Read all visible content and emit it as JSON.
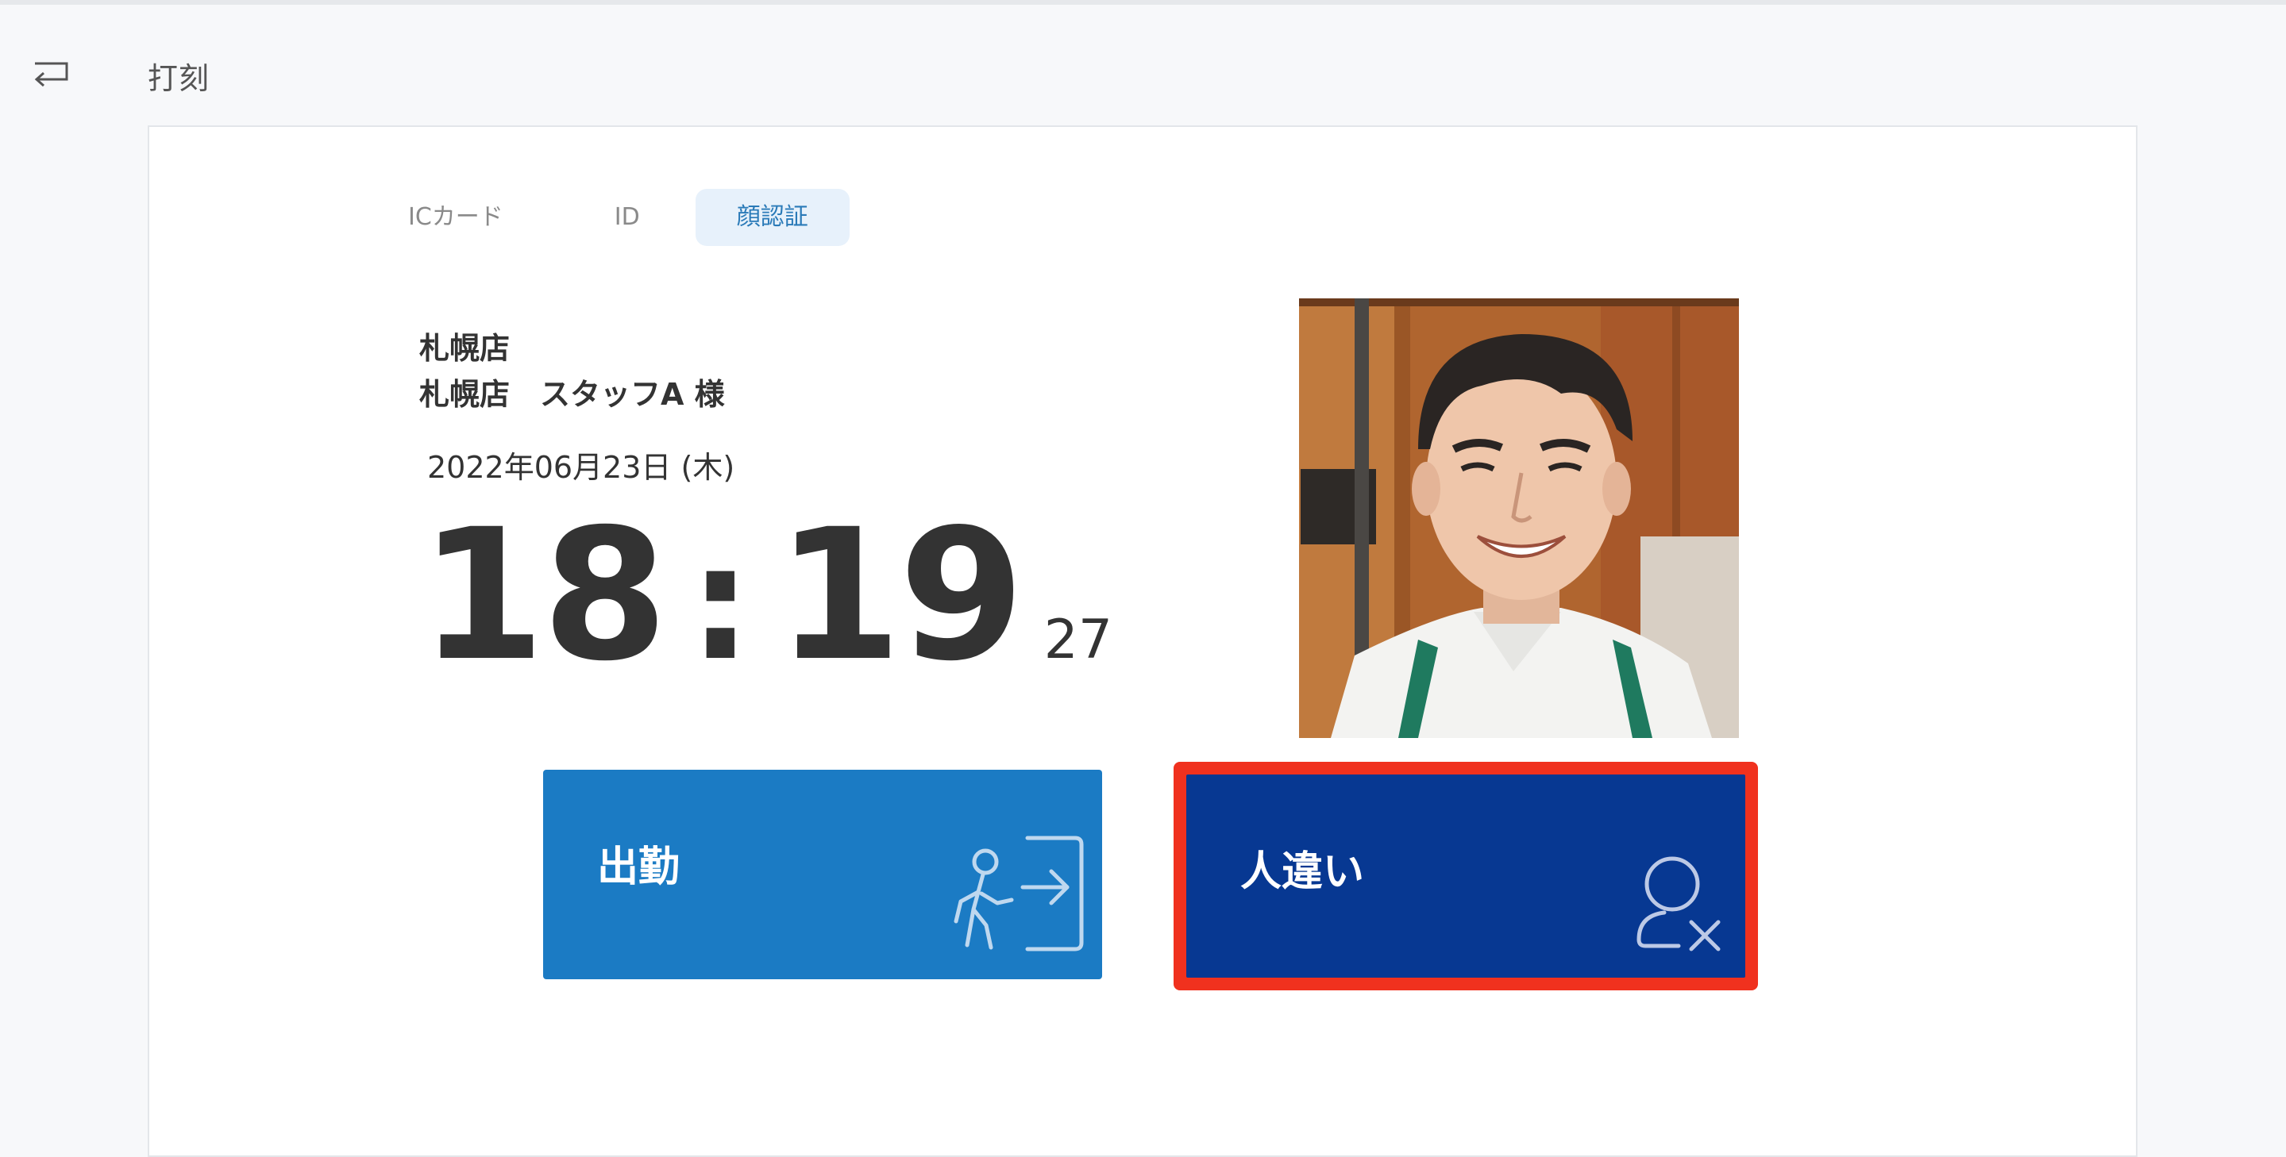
{
  "header": {
    "title": "打刻"
  },
  "tabs": [
    {
      "label": "ICカード",
      "active": false
    },
    {
      "label": "ID",
      "active": false
    },
    {
      "label": "顔認証",
      "active": true
    }
  ],
  "info": {
    "store": "札幌店",
    "staff": "札幌店　スタッフA 様",
    "date": "2022年06月23日 (木)"
  },
  "clock": {
    "hours": "18",
    "separator": ":",
    "minutes": "19",
    "seconds": "27"
  },
  "actions": {
    "clock_in_label": "出勤",
    "wrong_person_label": "人違い"
  },
  "colors": {
    "clock_in": "#1b7bc4",
    "wrong_person": "#073892",
    "highlight": "#f0311e",
    "active_tab_bg": "#e7f1fb",
    "active_tab_text": "#2a7ab8"
  }
}
